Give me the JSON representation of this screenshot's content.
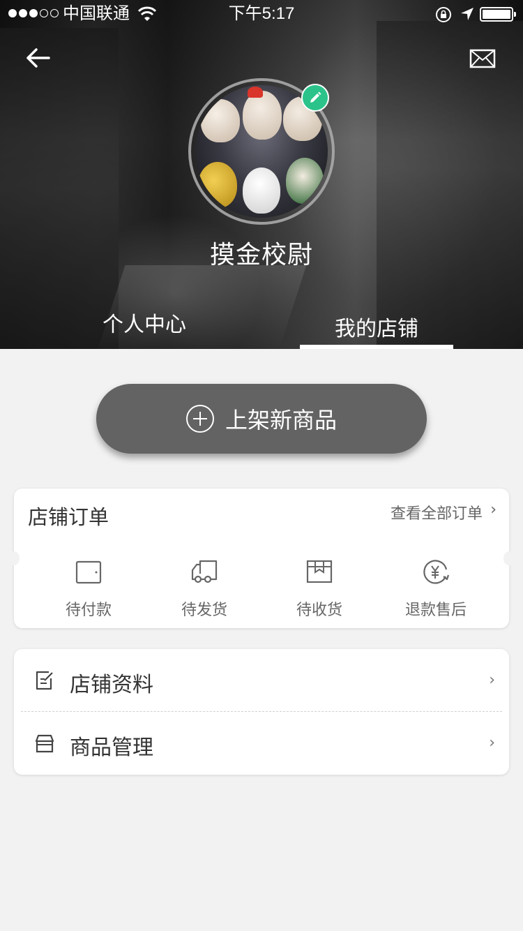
{
  "status_bar": {
    "carrier": "中国联通",
    "time": "下午5:17"
  },
  "profile": {
    "username": "摸金校尉"
  },
  "tabs": [
    {
      "label": "个人中心",
      "active": false
    },
    {
      "label": "我的店铺",
      "active": true
    }
  ],
  "add_product": {
    "label": "上架新商品"
  },
  "orders": {
    "title": "店铺订单",
    "view_all": "查看全部订单",
    "statuses": [
      {
        "label": "待付款",
        "icon": "wallet-icon"
      },
      {
        "label": "待发货",
        "icon": "truck-icon"
      },
      {
        "label": "待收货",
        "icon": "package-icon"
      },
      {
        "label": "退款售后",
        "icon": "refund-icon"
      }
    ]
  },
  "menu": [
    {
      "label": "店铺资料",
      "icon": "edit-note-icon"
    },
    {
      "label": "商品管理",
      "icon": "store-icon"
    }
  ],
  "colors": {
    "edit_badge": "#2bc38a",
    "add_button": "#636363",
    "page_bg": "#f2f2f2"
  }
}
